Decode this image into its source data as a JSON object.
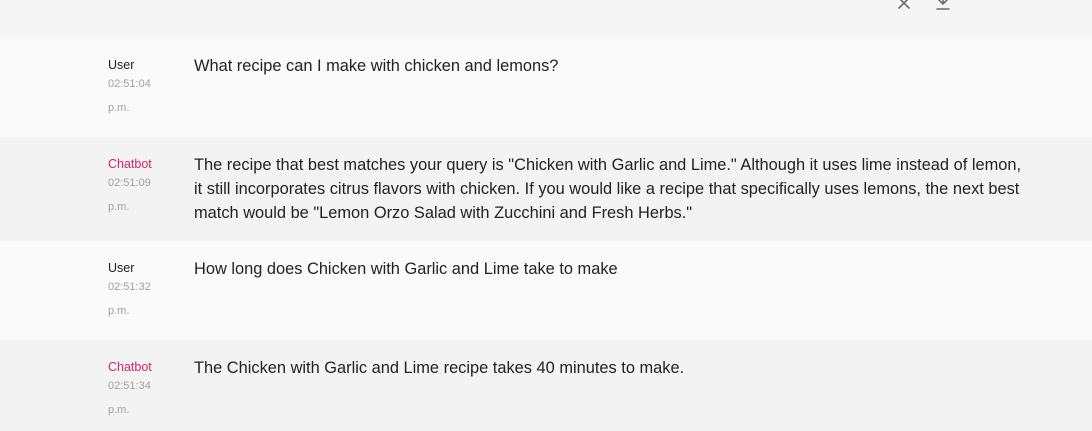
{
  "toolbar": {
    "close_icon": "close-icon",
    "download_icon": "download-icon"
  },
  "messages": [
    {
      "role": "User",
      "time": "02:51:04 p.m.",
      "text": "What recipe can I make with chicken and lemons?"
    },
    {
      "role": "Chatbot",
      "time": "02:51:09 p.m.",
      "text": "The recipe that best matches your query is \"Chicken with Garlic and Lime.\" Although it uses lime instead of lemon, it still incorporates citrus flavors with chicken. If you would like a recipe that specifically uses lemons, the next best match would be \"Lemon Orzo Salad with Zucchini and Fresh Herbs.\""
    },
    {
      "role": "User",
      "time": "02:51:32 p.m.",
      "text": "How long does Chicken with Garlic and Lime take to make"
    },
    {
      "role": "Chatbot",
      "time": "02:51:34 p.m.",
      "text": "The Chicken with Garlic and Lime recipe takes 40 minutes to make."
    }
  ],
  "colors": {
    "chatbot_accent": "#d6246b",
    "user_row_bg": "#fafafa",
    "bot_row_bg": "#f3f3f3"
  }
}
